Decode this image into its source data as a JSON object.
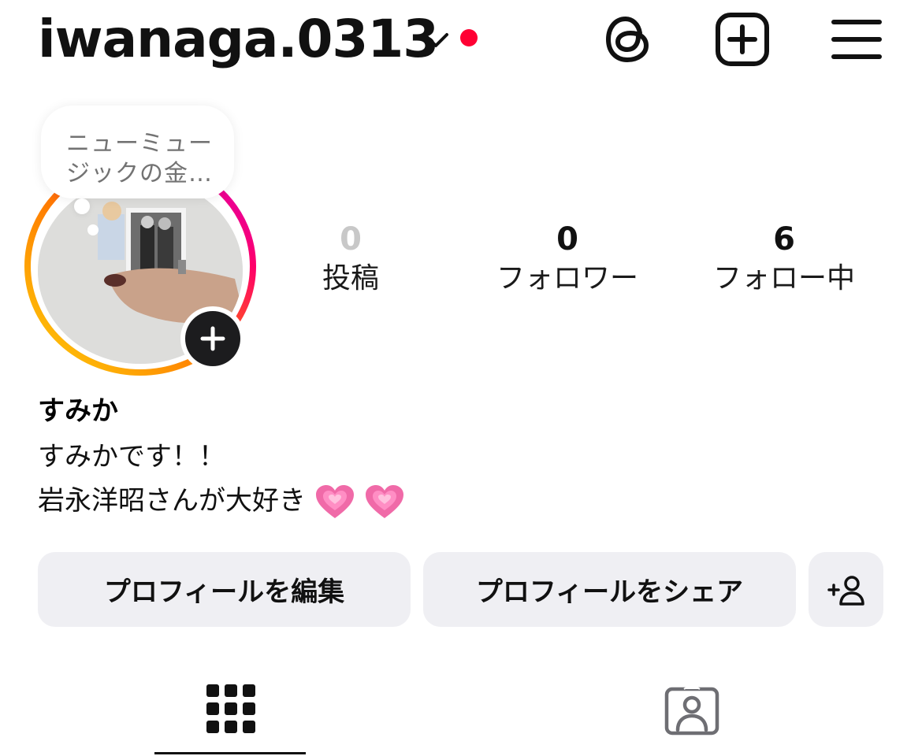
{
  "header": {
    "username": "iwanaga.0313",
    "icons": [
      "chevron-down-icon",
      "notification-dot",
      "threads-icon",
      "create-post-icon",
      "menu-icon"
    ],
    "notification_color": "#ff0033"
  },
  "profile": {
    "note": "ニューミュージックの金…",
    "stats": [
      {
        "value": "0",
        "label": "投稿"
      },
      {
        "value": "0",
        "label": "フォロワー"
      },
      {
        "value": "6",
        "label": "フォロー中"
      }
    ],
    "display_name": "すみか",
    "bio_lines": [
      "すみかです！！",
      "岩永洋昭さんが大好き"
    ],
    "bio_emoji": "growing-heart-emoji"
  },
  "actions": {
    "edit_label": "プロフィールを編集",
    "share_label": "プロフィールをシェア",
    "discover_icon": "add-person-icon"
  },
  "tabs": [
    {
      "icon": "grid-icon",
      "active": true
    },
    {
      "icon": "tagged-person-icon",
      "active": false
    }
  ],
  "colors": {
    "button_bg": "#efeff3",
    "story_ring": [
      "#fdd10b",
      "#ff7a00",
      "#ff0069",
      "#d300c5"
    ]
  }
}
